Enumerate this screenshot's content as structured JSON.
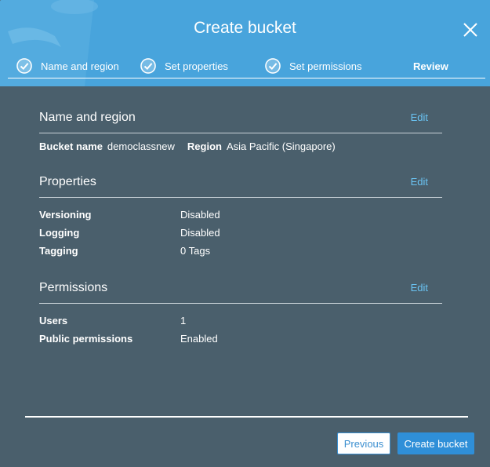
{
  "dialog": {
    "title": "Create bucket"
  },
  "steps": [
    {
      "label": "Name and region",
      "completed": true
    },
    {
      "label": "Set properties",
      "completed": true
    },
    {
      "label": "Set permissions",
      "completed": true
    },
    {
      "label": "Review",
      "completed": false,
      "current": true
    }
  ],
  "sections": {
    "name_region": {
      "title": "Name and region",
      "edit_label": "Edit",
      "bucket_name_label": "Bucket name",
      "bucket_name_value": "democlassnew",
      "region_label": "Region",
      "region_value": "Asia Pacific (Singapore)"
    },
    "properties": {
      "title": "Properties",
      "edit_label": "Edit",
      "rows": [
        {
          "label": "Versioning",
          "value": "Disabled"
        },
        {
          "label": "Logging",
          "value": "Disabled"
        },
        {
          "label": "Tagging",
          "value": "0 Tags"
        }
      ]
    },
    "permissions": {
      "title": "Permissions",
      "edit_label": "Edit",
      "rows": [
        {
          "label": "Users",
          "value": "1"
        },
        {
          "label": "Public permissions",
          "value": "Enabled"
        }
      ]
    }
  },
  "footer": {
    "previous_label": "Previous",
    "create_label": "Create bucket"
  },
  "colors": {
    "header_bg": "#48a4dc",
    "body_bg": "#4a5f6c",
    "link": "#6ac3f2",
    "primary_button": "#2f8fd8"
  },
  "icons": {
    "close": "close-icon",
    "step_done": "check-circle-icon"
  }
}
